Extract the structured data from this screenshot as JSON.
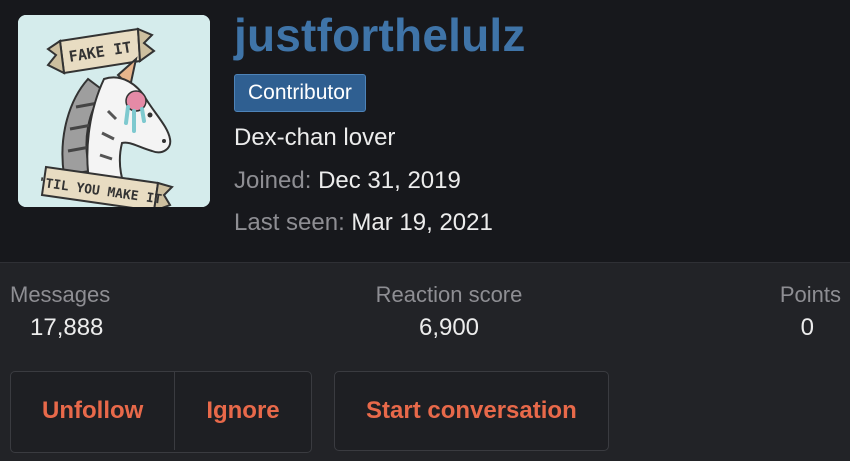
{
  "profile": {
    "username": "justforthelulz",
    "badge": "Contributor",
    "tagline": "Dex-chan lover",
    "joined_label": "Joined:",
    "joined_value": "Dec 31, 2019",
    "last_seen_label": "Last seen:",
    "last_seen_value": "Mar 19, 2021",
    "avatar": {
      "banner_top": "FAKE IT",
      "banner_bottom": "'TIL YOU MAKE IT",
      "icon": "unicorn-icon"
    }
  },
  "stats": {
    "messages_label": "Messages",
    "messages_value": "17,888",
    "reaction_label": "Reaction score",
    "reaction_value": "6,900",
    "points_label": "Points",
    "points_value": "0"
  },
  "actions": {
    "unfollow": "Unfollow",
    "ignore": "Ignore",
    "start_conversation": "Start conversation"
  },
  "colors": {
    "username": "#3f74a8",
    "badge_bg": "#2f5f91",
    "action_text": "#e8694a",
    "background": "#17181c",
    "panel": "#222327"
  }
}
